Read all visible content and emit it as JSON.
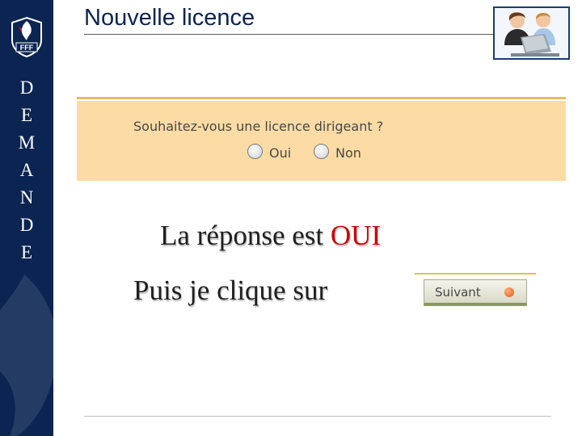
{
  "sidebar": {
    "logo_text": "FFF",
    "vertical_letters": [
      "D",
      "E",
      "M",
      "A",
      "N",
      "D",
      "E"
    ]
  },
  "header": {
    "title": "Nouvelle licence"
  },
  "form": {
    "question": "Souhaitez-vous une licence dirigeant ?",
    "options": [
      {
        "label": "Oui",
        "selected": false
      },
      {
        "label": "Non",
        "selected": false
      }
    ]
  },
  "instructions": {
    "answer_prefix": "La réponse est ",
    "answer_value": "OUI",
    "click_text": "Puis je clique sur"
  },
  "next_button": {
    "label": "Suivant"
  },
  "colors": {
    "sidebar": "#0b2451",
    "panel": "#fcdca4",
    "panel_border": "#e6bd5c",
    "highlight": "#cc0000",
    "button_dot": "#e0561a"
  }
}
